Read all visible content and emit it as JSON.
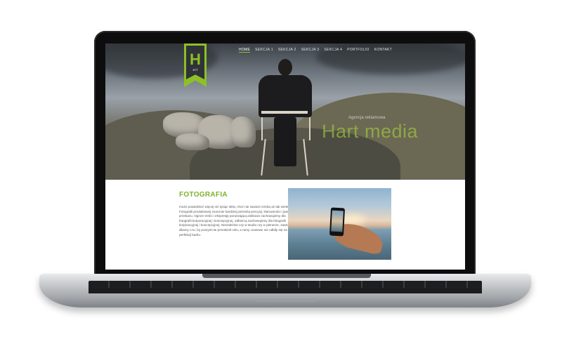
{
  "site": {
    "logo": {
      "letter": "H",
      "sub": "art",
      "accent": "#8dbf27"
    },
    "nav": [
      {
        "label": "HOME",
        "active": true
      },
      {
        "label": "SEKCJA 1"
      },
      {
        "label": "SEKCJA 2"
      },
      {
        "label": "SEKCJA 3"
      },
      {
        "label": "SEKCJA 4"
      },
      {
        "label": "PORTFOLIO"
      },
      {
        "label": "KONTAKT"
      }
    ],
    "hero": {
      "kicker": "Agencja reklamowa",
      "title": "Hart media"
    },
    "section": {
      "title": "FOTOGRAFIA",
      "text": "może powiedzieć więcej niż tysiąc słów, choć nie zawsze trzeba aż tak wiele. Fotografii produktowej znacznie bardziej potrzeba precyzji, klarowności i jasności przekazu. Ogrom treści i ekspresję poruszającą dotkowo zachowujemy dla fotografii korporacyjnej i koncepcyjnej, odbiorcą zachowujemy dla fotografii korporacyjnej i koncepcyjnej. Niezależnie czy w studio czy w plenerze, zawsze dbamy o to, by pomysł nie przesłonił celu, a ramy czasowe nie odbiły się na perfekcji kadru."
    }
  }
}
